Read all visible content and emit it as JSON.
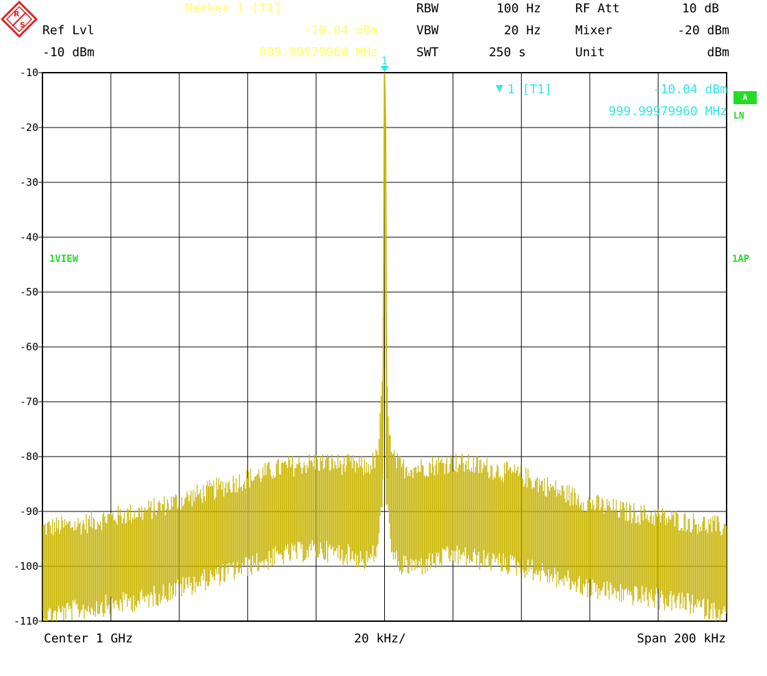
{
  "header": {
    "marker_title": "Marker 1 [T1]",
    "marker_level": "-10.04 dBm",
    "marker_freq": "999.99979960 MHz",
    "ref_lvl_label": "Ref Lvl",
    "ref_lvl_value": "-10 dBm",
    "rbw_label": "RBW",
    "rbw_value": "100 Hz",
    "vbw_label": "VBW",
    "vbw_value": "20 Hz",
    "swt_label": "SWT",
    "swt_value": "250 s",
    "rf_att_label": "RF Att",
    "rf_att_value": "10 dB",
    "mixer_label": "Mixer",
    "mixer_value": "-20 dBm",
    "unit_label": "Unit",
    "unit_value": "dBm"
  },
  "marker_box": {
    "label": "1 [T1]",
    "level": "-10.04 dBm",
    "freq": "999.99979960 MHz",
    "marker_number": "1"
  },
  "side_labels": {
    "trace_view": "1VIEW",
    "badge_a": "A",
    "ln": "LN",
    "ap": "1AP"
  },
  "footer": {
    "center": "Center 1 GHz",
    "div": "20 kHz/",
    "span": "Span 200 kHz"
  },
  "colors": {
    "trace": "#c8b400",
    "grid": "#000000",
    "marker": "#33e6e6",
    "header_marker": "#ffff66",
    "status_green": "#22dd22",
    "logo": "#e02020"
  },
  "chart_data": {
    "type": "line",
    "title": "",
    "xlabel": "",
    "ylabel": "",
    "x_unit": "kHz offset from center",
    "xlim": [
      -100,
      100
    ],
    "ylim": [
      -110,
      -10
    ],
    "y_ticks": [
      -10,
      -20,
      -30,
      -40,
      -50,
      -60,
      -70,
      -80,
      -90,
      -100,
      -110
    ],
    "x_divisions": 10,
    "grid": true,
    "series": [
      {
        "name": "",
        "envelope": {
          "x": [
            -100,
            -90,
            -80,
            -70,
            -60,
            -50,
            -40,
            -30,
            -20,
            -10,
            -5,
            -2,
            -0.5,
            0,
            0.5,
            2,
            5,
            10,
            20,
            30,
            40,
            50,
            60,
            70,
            80,
            90,
            100
          ],
          "upper": [
            -93,
            -92.5,
            -91,
            -90,
            -88,
            -86,
            -84,
            -82,
            -81,
            -81.5,
            -82,
            -80,
            -66,
            -10.04,
            -66,
            -80,
            -82,
            -82,
            -81,
            -82,
            -83.5,
            -86,
            -88.5,
            -90,
            -91,
            -92,
            -93
          ],
          "lower": [
            -107,
            -106,
            -105,
            -104,
            -102,
            -100,
            -98,
            -96,
            -95,
            -96,
            -97,
            -95,
            -85,
            -10.04,
            -85,
            -96,
            -98,
            -98,
            -96,
            -97,
            -98,
            -100,
            -102,
            -103,
            -104,
            -105,
            -107
          ]
        }
      }
    ],
    "marker": {
      "x": 0,
      "y": -10.04
    }
  }
}
